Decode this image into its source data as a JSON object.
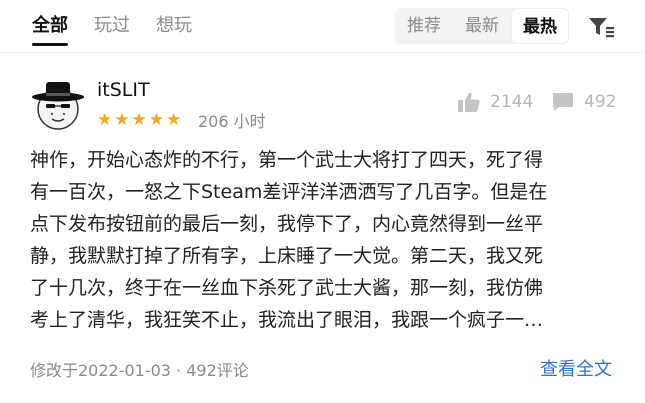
{
  "tabs": [
    {
      "label": "全部",
      "active": true
    },
    {
      "label": "玩过",
      "active": false
    },
    {
      "label": "想玩",
      "active": false
    }
  ],
  "sort_options": [
    {
      "label": "推荐",
      "active": false
    },
    {
      "label": "最新",
      "active": false
    },
    {
      "label": "最热",
      "active": true
    }
  ],
  "filter_icon": "filter-icon",
  "review": {
    "username": "itSLIT",
    "rating_stars": 5,
    "rating_max": 5,
    "play_time": "206 小时",
    "likes": "2144",
    "comments": "492",
    "text_lines": [
      "神作，开始心态炸的不行，第一个武士大将打了四天，死了得",
      "有一百次，一怒之下Steam差评洋洋洒洒写了几百字。但是在",
      "点下发布按钮前的最后一刻，我停下了，内心竟然得到一丝平",
      "静，我默默打掉了所有字，上床睡了一大觉。第二天，我又死",
      "了十几次，终于在一丝血下杀死了武士大酱，那一刻，我仿佛",
      "考上了清华，我狂笑不止，我流出了眼泪，我跟一个疯子一…"
    ],
    "meta": "修改于2022-01-03 · 492评论",
    "view_all": "查看全文"
  },
  "colors": {
    "star": "#f5a623",
    "link": "#2c74c7",
    "muted": "#8a8a8a"
  }
}
